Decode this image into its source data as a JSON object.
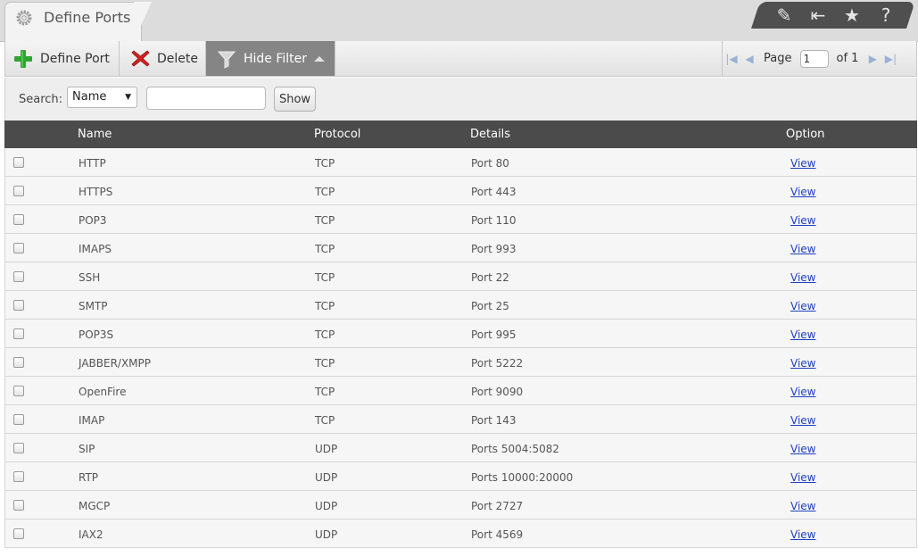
{
  "tab": {
    "title": "Define Ports",
    "icon": "gear-icon"
  },
  "top_icons": [
    {
      "name": "edit-icon",
      "glyph": "✎"
    },
    {
      "name": "collapse-icon",
      "glyph": "⇤"
    },
    {
      "name": "star-icon",
      "glyph": "★"
    },
    {
      "name": "help-icon",
      "glyph": "?"
    }
  ],
  "toolbar": {
    "define_label": "Define Port",
    "delete_label": "Delete",
    "filter_label": "Hide Filter"
  },
  "pager": {
    "page_label": "Page",
    "page_value": "1",
    "of_label": "of 1"
  },
  "search": {
    "label": "Search:",
    "field_selected": "Name",
    "value": "",
    "show_label": "Show"
  },
  "columns": {
    "name": "Name",
    "protocol": "Protocol",
    "details": "Details",
    "option": "Option"
  },
  "rows": [
    {
      "name": "HTTP",
      "protocol": "TCP",
      "details": "Port 80",
      "option": "View"
    },
    {
      "name": "HTTPS",
      "protocol": "TCP",
      "details": "Port 443",
      "option": "View"
    },
    {
      "name": "POP3",
      "protocol": "TCP",
      "details": "Port 110",
      "option": "View"
    },
    {
      "name": "IMAPS",
      "protocol": "TCP",
      "details": "Port 993",
      "option": "View"
    },
    {
      "name": "SSH",
      "protocol": "TCP",
      "details": "Port 22",
      "option": "View"
    },
    {
      "name": "SMTP",
      "protocol": "TCP",
      "details": "Port 25",
      "option": "View"
    },
    {
      "name": "POP3S",
      "protocol": "TCP",
      "details": "Port 995",
      "option": "View"
    },
    {
      "name": "JABBER/XMPP",
      "protocol": "TCP",
      "details": "Port 5222",
      "option": "View"
    },
    {
      "name": "OpenFire",
      "protocol": "TCP",
      "details": "Port 9090",
      "option": "View"
    },
    {
      "name": "IMAP",
      "protocol": "TCP",
      "details": "Port 143",
      "option": "View"
    },
    {
      "name": "SIP",
      "protocol": "UDP",
      "details": "Ports 5004:5082",
      "option": "View"
    },
    {
      "name": "RTP",
      "protocol": "UDP",
      "details": "Ports 10000:20000",
      "option": "View"
    },
    {
      "name": "MGCP",
      "protocol": "UDP",
      "details": "Port 2727",
      "option": "View"
    },
    {
      "name": "IAX2",
      "protocol": "UDP",
      "details": "Port 4569",
      "option": "View"
    }
  ],
  "colors": {
    "header_bg": "#4b4b4b",
    "link": "#1f3fbf",
    "add_green": "#2fa52f",
    "delete_red": "#d42020",
    "filter_bg": "#858585"
  }
}
